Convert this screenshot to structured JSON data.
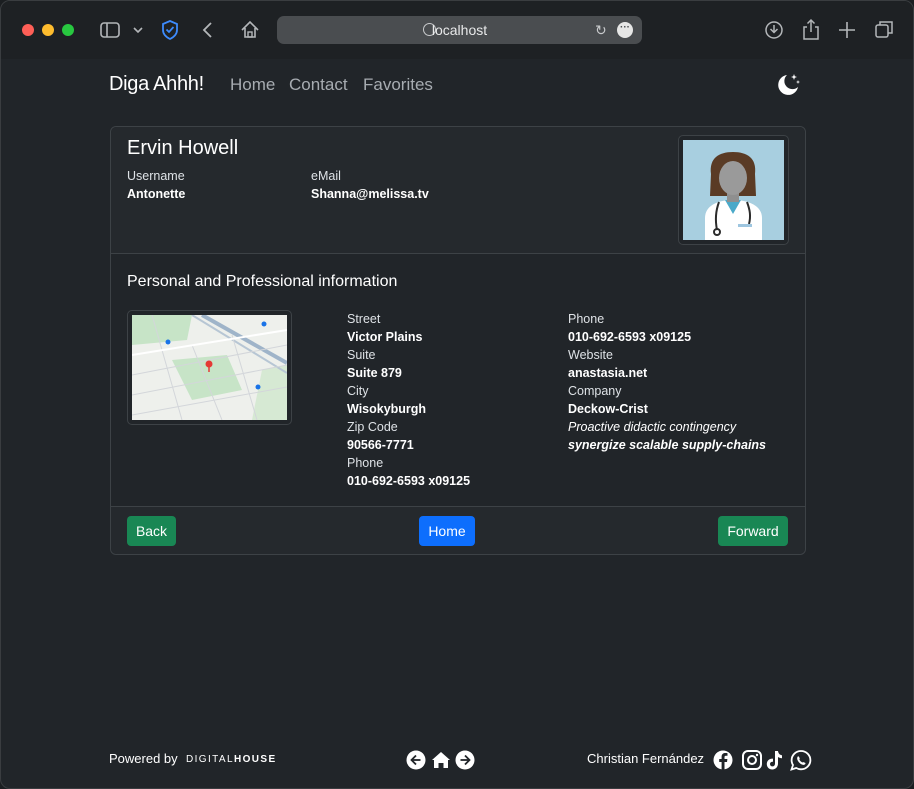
{
  "browser": {
    "url": "localhost",
    "icons": [
      "sidebar-icon",
      "chevron-down-icon",
      "shield-icon",
      "back-arrow-icon",
      "home-icon",
      "download-icon",
      "share-icon",
      "new-tab-icon",
      "tabs-icon"
    ]
  },
  "navbar": {
    "brand": "Diga Ahhh!",
    "links": [
      "Home",
      "Contact",
      "Favorites"
    ]
  },
  "profile": {
    "name": "Ervin Howell",
    "username_label": "Username",
    "username": "Antonette",
    "email_label": "eMail",
    "email": "Shanna@melissa.tv"
  },
  "details": {
    "section_title": "Personal and Professional information",
    "address": {
      "street_label": "Street",
      "street": "Victor Plains",
      "suite_label": "Suite",
      "suite": "Suite 879",
      "city_label": "City",
      "city": "Wisokyburgh",
      "zip_label": "Zip Code",
      "zip": "90566-7771",
      "phone_label": "Phone",
      "phone": "010-692-6593 x09125"
    },
    "contact": {
      "phone_label": "Phone",
      "phone": "010-692-6593 x09125",
      "website_label": "Website",
      "website": "anastasia.net",
      "company_label": "Company",
      "company": "Deckow-Crist",
      "catch_phrase": "Proactive didactic contingency",
      "bs": "synergize scalable supply-chains"
    }
  },
  "actions": {
    "back": "Back",
    "home": "Home",
    "forward": "Forward"
  },
  "footer": {
    "powered_by": "Powered by",
    "logo_light": "DIGITAL",
    "logo_bold": "HOUSE",
    "author": "Christian Fernández"
  },
  "colors": {
    "background": "#212529",
    "success": "#198754",
    "primary": "#0d6efd"
  }
}
